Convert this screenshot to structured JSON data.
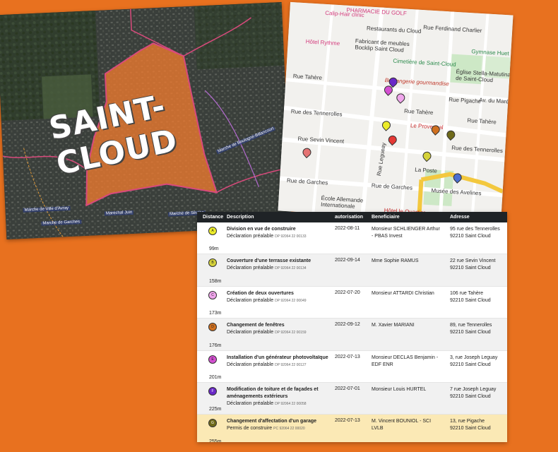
{
  "satellite": {
    "title": "SAINT-CLOUD",
    "road_labels": [
      "Marche de Boulogne-Billancourt",
      "Maréchal Juin",
      "Marche de Garches",
      "Marche de Ville d'Avray",
      "Marche de Sèvres"
    ],
    "overlay_color": "#ee7a2e"
  },
  "map": {
    "labels": {
      "pharmacie": "PHARMACIE DU GOLF",
      "calip": "Calip-Hair clinic",
      "restaurants": "Restaurants du Cloud",
      "hotel": "Hôtel Rythme",
      "fabricant": "Fabricant de meubles Bocklip Saint Cloud",
      "ferdinand": "Rue Ferdinand Charlier",
      "gymnase": "Gymnase Huet",
      "cimetiere": "Cimetière de Saint-Cloud",
      "boulangerie": "Boulangerie gourmandise",
      "eglise": "Église Stella-Matutina de Saint-Cloud",
      "tahere1": "Rue Tahère",
      "tahere2": "Rue Tahère",
      "tahere3": "Rue Tahère",
      "pigache": "Rue Pigache",
      "avmarne": "Av. du Maréchal",
      "tennerolles1": "Rue des Tennerolles",
      "tennerolles2": "Rue des Tennerolles",
      "leprovencal": "Le Provençal",
      "sevin": "Rue Sevin Vincent",
      "laposte": "La Poste",
      "garches1": "Rue de Garches",
      "garches2": "Rue de Garches",
      "musee": "Musée des Avelines",
      "ecole": "École Allemande Internationale",
      "hotelquartier": "Hôtel le Quartier",
      "leguay": "Rue Legueay"
    }
  },
  "table": {
    "headers": {
      "distance": "Distance",
      "description": "Description",
      "autorisation": "autorisation",
      "beneficiaire": "Beneficiaire",
      "adresse": "Adresse"
    },
    "rows": [
      {
        "letter": "A",
        "color": "#ecec2a",
        "title": "Division en vue de construire",
        "type": "Déclaration préalable",
        "ref": "DP 92064 22 00133",
        "date": "2022-08-11",
        "ben": "Monsieur SCHLIENGER Arthur - PBAS Invest",
        "addr1": "95 rue des Tennerolles",
        "addr2": "92210 Saint Cloud",
        "dist": "99m"
      },
      {
        "letter": "B",
        "color": "#d5d23a",
        "title": "Couverture d'une terrasse existante",
        "type": "Déclaration préalable",
        "ref": "DP 92064 22 00134",
        "date": "2022-09-14",
        "ben": "Mme Sophie RAMUS",
        "addr1": "22 rue Sevin Vincent",
        "addr2": "92210 Saint Cloud",
        "dist": "158m"
      },
      {
        "letter": "C",
        "color": "#f0a6ec",
        "title": "Création de deux ouvertures",
        "type": "Déclaration préalable",
        "ref": "DP 92064 22 00049",
        "date": "2022-07-20",
        "ben": "Monsieur ATTARDI Christian",
        "addr1": "106 rue Tahère",
        "addr2": "92210 Saint Cloud",
        "dist": "173m"
      },
      {
        "letter": "D",
        "color": "#d0701f",
        "title": "Changement de fenêtres",
        "type": "Déclaration préalable",
        "ref": "DP 92064 22 00159",
        "date": "2022-09-12",
        "ben": "M. Xavier MARIANI",
        "addr1": "89, rue Tennerolles",
        "addr2": "92210 Saint Cloud",
        "dist": "176m"
      },
      {
        "letter": "E",
        "color": "#d44fd1",
        "title": "Installation d'un générateur photovoltaïque",
        "type": "Déclaration préalable",
        "ref": "DP 92064 22 00127",
        "date": "2022-07-13",
        "ben": "Monsieur DECLAS Benjamin - EDF ENR",
        "addr1": "3, rue Joseph Leguay",
        "addr2": "92210 Saint Cloud",
        "dist": "201m"
      },
      {
        "letter": "F",
        "color": "#6a28c8",
        "title": "Modification de toiture et de façades et aménagements extérieurs",
        "type": "Déclaration préalable",
        "ref": "DP 92064 22 00058",
        "date": "2022-07-01",
        "ben": "Monsieur Louis HURTEL",
        "addr1": "7 rue Joseph Leguay",
        "addr2": "92210 Saint Cloud",
        "dist": "225m"
      },
      {
        "letter": "G",
        "color": "#6f6a1a",
        "title": "Changement d'affectation d'un garage",
        "type": "Permis de construire",
        "ref": "PC 92064 22 00020",
        "date": "2022-07-13",
        "ben": "M. Vincent BOUNIOL - SCI LVLB",
        "addr1": "13, rue Pigache",
        "addr2": "92210 Saint Cloud",
        "dist": "255m"
      }
    ]
  }
}
